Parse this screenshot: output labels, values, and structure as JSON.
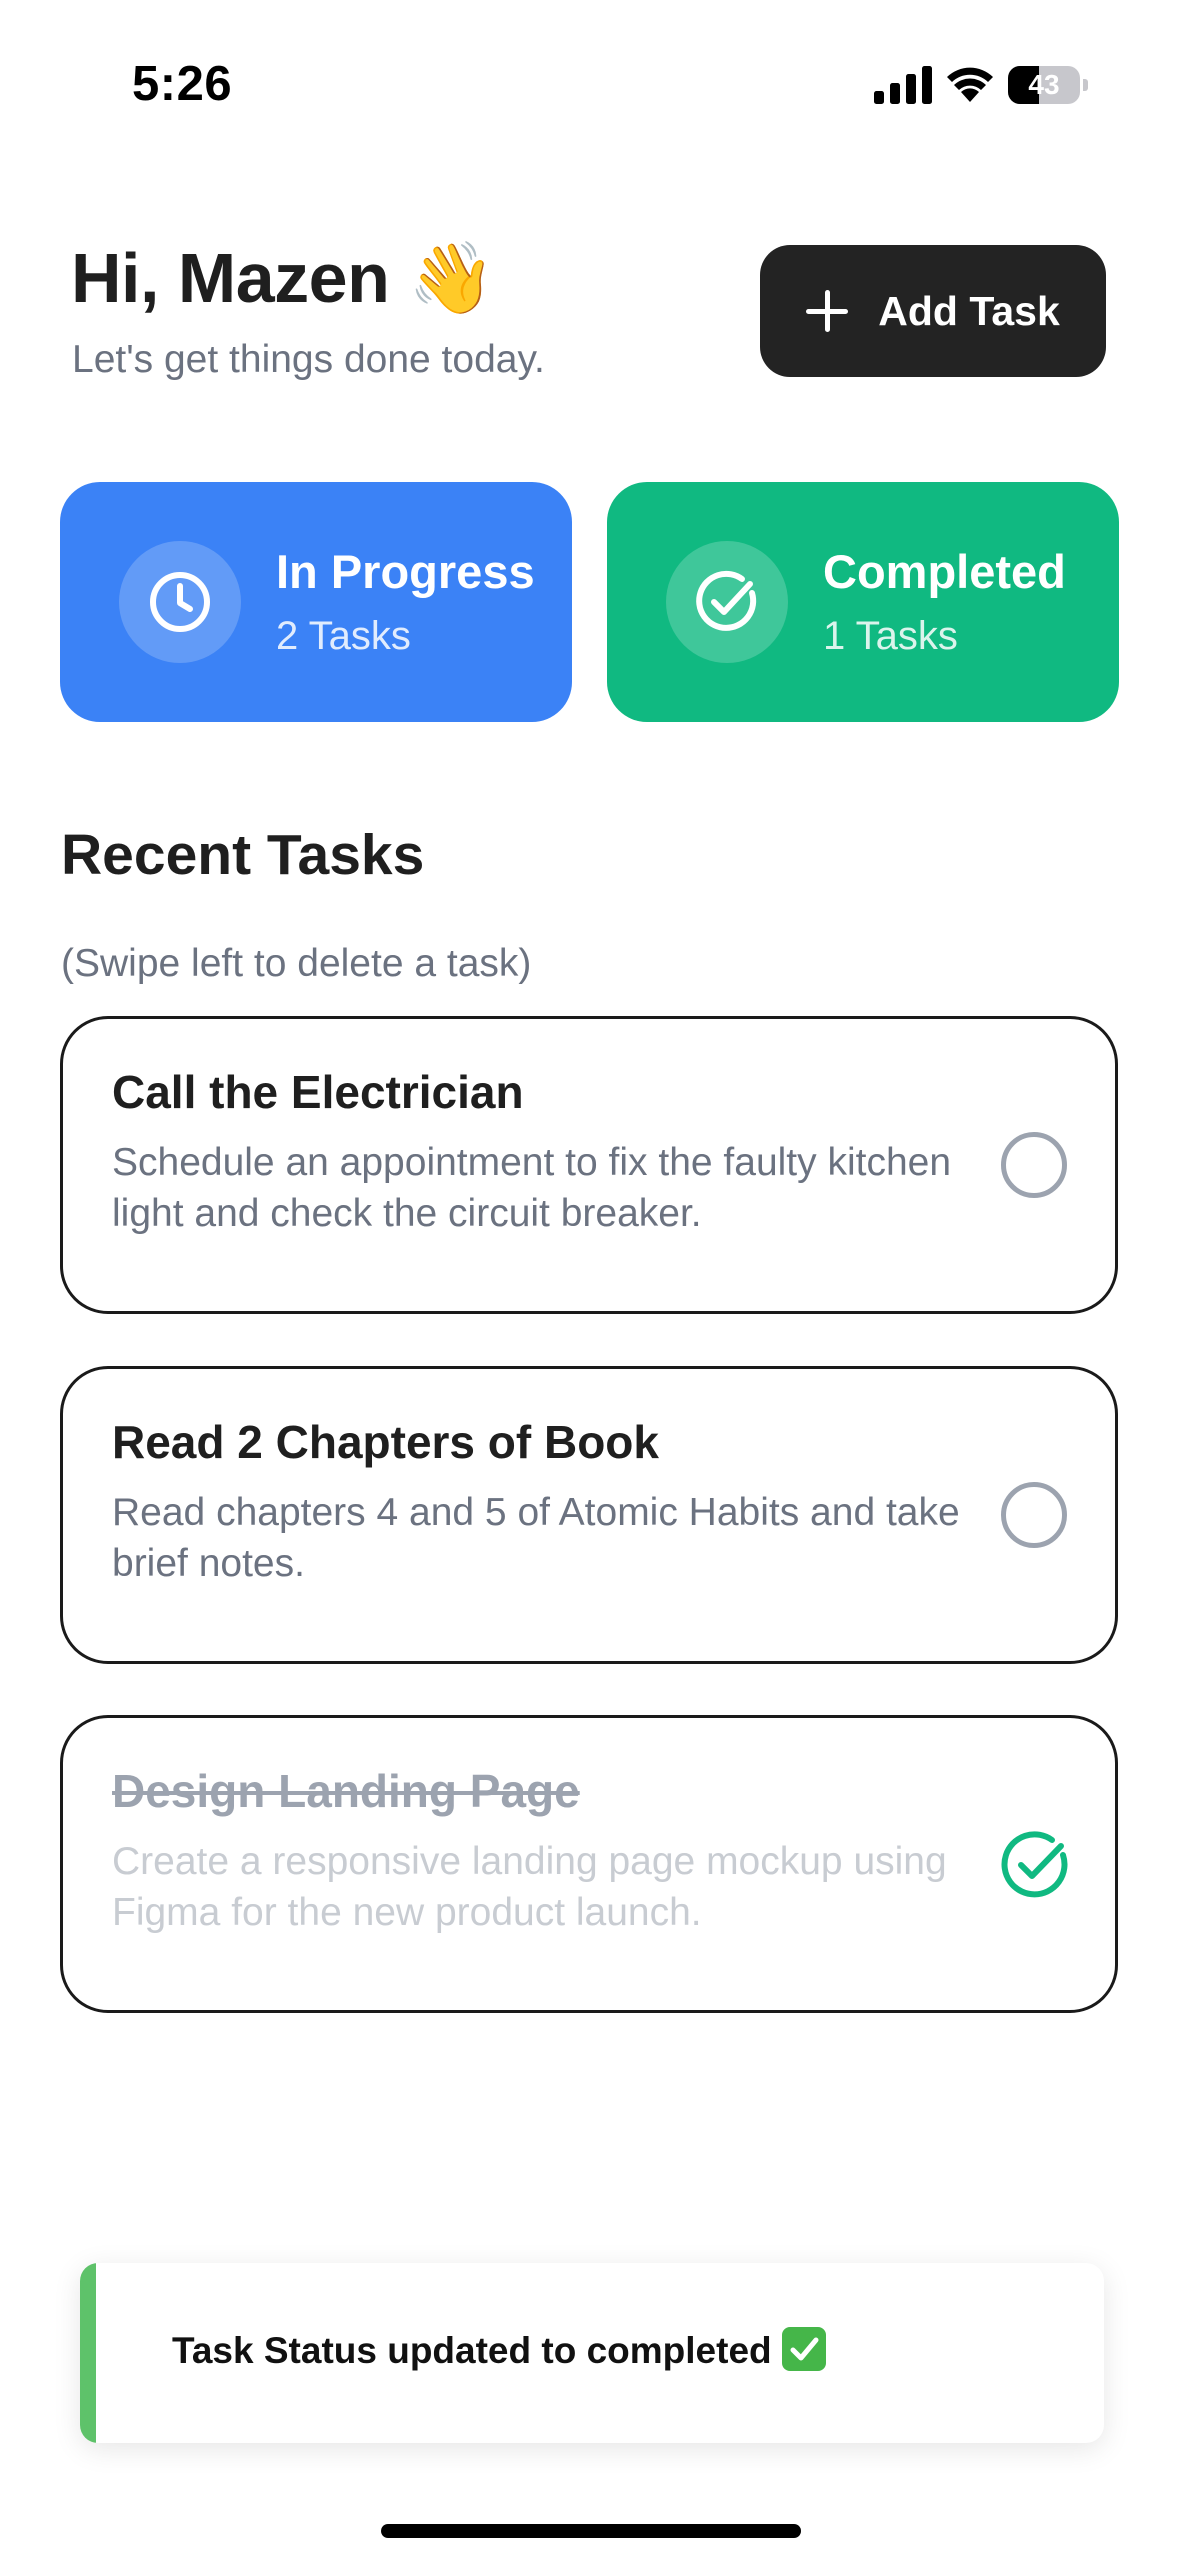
{
  "status_bar": {
    "time": "5:26",
    "battery_level": "43",
    "battery_fraction": 0.43
  },
  "header": {
    "greeting": "Hi, Mazen",
    "greeting_emoji": "👋",
    "subtitle": "Let's get things done today.",
    "add_task_label": "Add Task"
  },
  "stats": {
    "in_progress": {
      "title": "In Progress",
      "count": "2 Tasks",
      "icon": "clock-icon",
      "color": "#3b82f6"
    },
    "completed": {
      "title": "Completed",
      "count": "1 Tasks",
      "icon": "check-circle-icon",
      "color": "#10b981"
    }
  },
  "recent": {
    "title": "Recent Tasks",
    "hint": "(Swipe left to delete a task)",
    "tasks": [
      {
        "title": "Call the Electrician",
        "description": "Schedule an appointment to fix the faulty kitchen light and check the circuit breaker.",
        "completed": false
      },
      {
        "title": "Read 2 Chapters of Book",
        "description": "Read chapters 4 and 5 of Atomic Habits and take brief notes.",
        "completed": false
      },
      {
        "title": "Design Landing Page",
        "description": "Create a responsive landing page mockup using Figma for the new product launch.",
        "completed": true
      }
    ]
  },
  "toast": {
    "message": "Task Status updated to completed",
    "icon": "check-mark-button-icon",
    "accent_color": "#5ec26a"
  }
}
